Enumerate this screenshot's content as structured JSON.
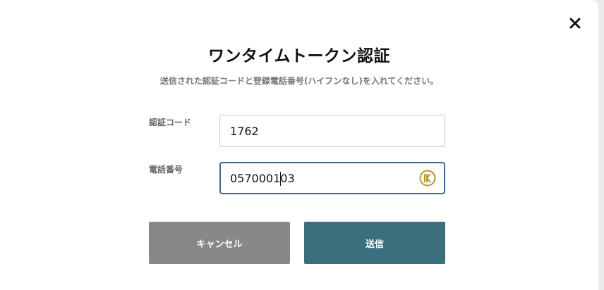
{
  "dialog": {
    "title": "ワンタイムトークン認証",
    "subtitle": "送信された認証コードと登録電話番号(ハイフンなし)を入れてください。",
    "close_icon": "close-icon"
  },
  "form": {
    "code": {
      "label": "認証コード",
      "value": "1762"
    },
    "phone": {
      "label": "電話番号",
      "value": "057000103",
      "autofill_icon": "keeper-autofill-icon"
    }
  },
  "buttons": {
    "cancel_label": "キャンセル",
    "submit_label": "送信"
  },
  "colors": {
    "focus_border": "#3a6a86",
    "cancel_bg": "#888888",
    "submit_bg": "#3b6f7e",
    "autofill_icon": "#b8962e"
  }
}
